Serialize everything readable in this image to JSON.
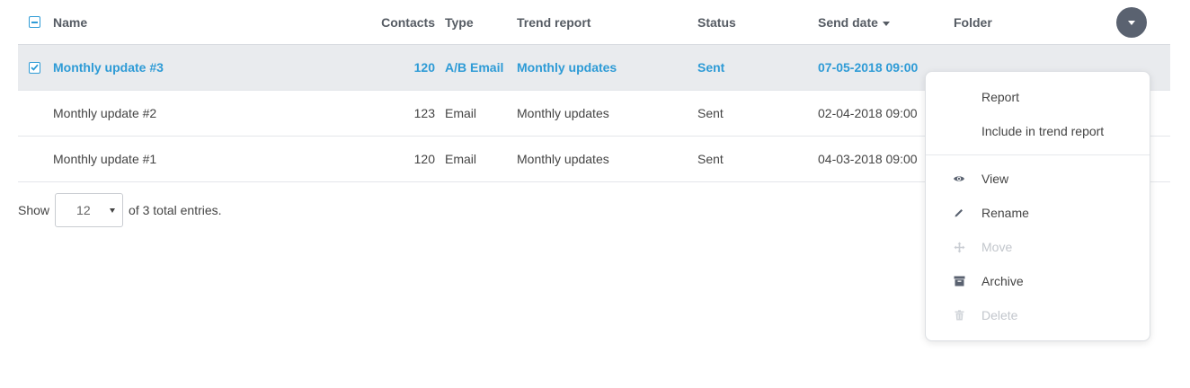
{
  "table": {
    "columns": {
      "name": "Name",
      "contacts": "Contacts",
      "type": "Type",
      "trend": "Trend report",
      "status": "Status",
      "send_date": "Send date",
      "folder": "Folder"
    },
    "rows": [
      {
        "name": "Monthly update #3",
        "contacts": "120",
        "type": "A/B Email",
        "trend": "Monthly updates",
        "status": "Sent",
        "send_date": "07-05-2018 09:00",
        "folder": "",
        "selected": true
      },
      {
        "name": "Monthly update #2",
        "contacts": "123",
        "type": "Email",
        "trend": "Monthly updates",
        "status": "Sent",
        "send_date": "02-04-2018 09:00",
        "folder": "",
        "selected": false
      },
      {
        "name": "Monthly update #1",
        "contacts": "120",
        "type": "Email",
        "trend": "Monthly updates",
        "status": "Sent",
        "send_date": "04-03-2018 09:00",
        "folder": "",
        "selected": false
      }
    ],
    "sort": {
      "column": "send_date",
      "direction": "desc"
    }
  },
  "pagination": {
    "show_label": "Show",
    "page_size": "12",
    "total_text": "of 3 total entries."
  },
  "context_menu": {
    "items": [
      {
        "label": "Report",
        "icon": "",
        "disabled": false
      },
      {
        "label": "Include in trend report",
        "icon": "",
        "disabled": false
      },
      {
        "label": "View",
        "icon": "eye-icon",
        "disabled": false
      },
      {
        "label": "Rename",
        "icon": "pencil-icon",
        "disabled": false
      },
      {
        "label": "Move",
        "icon": "move-icon",
        "disabled": true
      },
      {
        "label": "Archive",
        "icon": "archive-icon",
        "disabled": false
      },
      {
        "label": "Delete",
        "icon": "trash-icon",
        "disabled": true
      }
    ]
  },
  "colors": {
    "accent": "#2e9bd6",
    "selected_row_bg": "#e9ebee",
    "action_button": "#5a6270",
    "disabled_text": "#c2c6cc"
  }
}
